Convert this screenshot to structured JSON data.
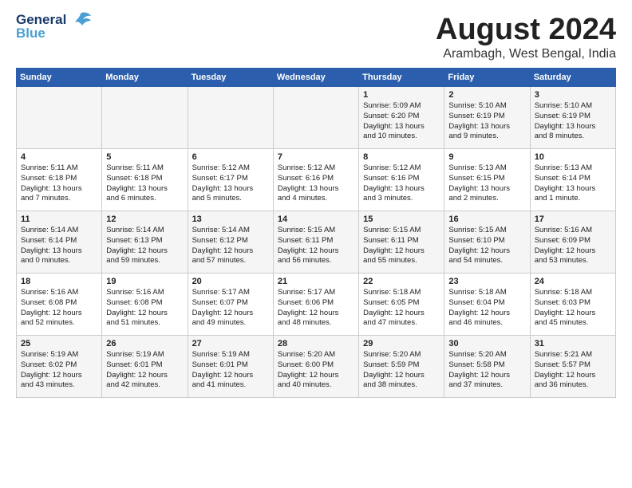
{
  "header": {
    "logo_line1": "General",
    "logo_line2": "Blue",
    "main_title": "August 2024",
    "subtitle": "Arambagh, West Bengal, India"
  },
  "calendar": {
    "days_of_week": [
      "Sunday",
      "Monday",
      "Tuesday",
      "Wednesday",
      "Thursday",
      "Friday",
      "Saturday"
    ],
    "weeks": [
      [
        {
          "day": "",
          "content": ""
        },
        {
          "day": "",
          "content": ""
        },
        {
          "day": "",
          "content": ""
        },
        {
          "day": "",
          "content": ""
        },
        {
          "day": "1",
          "content": "Sunrise: 5:09 AM\nSunset: 6:20 PM\nDaylight: 13 hours\nand 10 minutes."
        },
        {
          "day": "2",
          "content": "Sunrise: 5:10 AM\nSunset: 6:19 PM\nDaylight: 13 hours\nand 9 minutes."
        },
        {
          "day": "3",
          "content": "Sunrise: 5:10 AM\nSunset: 6:19 PM\nDaylight: 13 hours\nand 8 minutes."
        }
      ],
      [
        {
          "day": "4",
          "content": "Sunrise: 5:11 AM\nSunset: 6:18 PM\nDaylight: 13 hours\nand 7 minutes."
        },
        {
          "day": "5",
          "content": "Sunrise: 5:11 AM\nSunset: 6:18 PM\nDaylight: 13 hours\nand 6 minutes."
        },
        {
          "day": "6",
          "content": "Sunrise: 5:12 AM\nSunset: 6:17 PM\nDaylight: 13 hours\nand 5 minutes."
        },
        {
          "day": "7",
          "content": "Sunrise: 5:12 AM\nSunset: 6:16 PM\nDaylight: 13 hours\nand 4 minutes."
        },
        {
          "day": "8",
          "content": "Sunrise: 5:12 AM\nSunset: 6:16 PM\nDaylight: 13 hours\nand 3 minutes."
        },
        {
          "day": "9",
          "content": "Sunrise: 5:13 AM\nSunset: 6:15 PM\nDaylight: 13 hours\nand 2 minutes."
        },
        {
          "day": "10",
          "content": "Sunrise: 5:13 AM\nSunset: 6:14 PM\nDaylight: 13 hours\nand 1 minute."
        }
      ],
      [
        {
          "day": "11",
          "content": "Sunrise: 5:14 AM\nSunset: 6:14 PM\nDaylight: 13 hours\nand 0 minutes."
        },
        {
          "day": "12",
          "content": "Sunrise: 5:14 AM\nSunset: 6:13 PM\nDaylight: 12 hours\nand 59 minutes."
        },
        {
          "day": "13",
          "content": "Sunrise: 5:14 AM\nSunset: 6:12 PM\nDaylight: 12 hours\nand 57 minutes."
        },
        {
          "day": "14",
          "content": "Sunrise: 5:15 AM\nSunset: 6:11 PM\nDaylight: 12 hours\nand 56 minutes."
        },
        {
          "day": "15",
          "content": "Sunrise: 5:15 AM\nSunset: 6:11 PM\nDaylight: 12 hours\nand 55 minutes."
        },
        {
          "day": "16",
          "content": "Sunrise: 5:15 AM\nSunset: 6:10 PM\nDaylight: 12 hours\nand 54 minutes."
        },
        {
          "day": "17",
          "content": "Sunrise: 5:16 AM\nSunset: 6:09 PM\nDaylight: 12 hours\nand 53 minutes."
        }
      ],
      [
        {
          "day": "18",
          "content": "Sunrise: 5:16 AM\nSunset: 6:08 PM\nDaylight: 12 hours\nand 52 minutes."
        },
        {
          "day": "19",
          "content": "Sunrise: 5:16 AM\nSunset: 6:08 PM\nDaylight: 12 hours\nand 51 minutes."
        },
        {
          "day": "20",
          "content": "Sunrise: 5:17 AM\nSunset: 6:07 PM\nDaylight: 12 hours\nand 49 minutes."
        },
        {
          "day": "21",
          "content": "Sunrise: 5:17 AM\nSunset: 6:06 PM\nDaylight: 12 hours\nand 48 minutes."
        },
        {
          "day": "22",
          "content": "Sunrise: 5:18 AM\nSunset: 6:05 PM\nDaylight: 12 hours\nand 47 minutes."
        },
        {
          "day": "23",
          "content": "Sunrise: 5:18 AM\nSunset: 6:04 PM\nDaylight: 12 hours\nand 46 minutes."
        },
        {
          "day": "24",
          "content": "Sunrise: 5:18 AM\nSunset: 6:03 PM\nDaylight: 12 hours\nand 45 minutes."
        }
      ],
      [
        {
          "day": "25",
          "content": "Sunrise: 5:19 AM\nSunset: 6:02 PM\nDaylight: 12 hours\nand 43 minutes."
        },
        {
          "day": "26",
          "content": "Sunrise: 5:19 AM\nSunset: 6:01 PM\nDaylight: 12 hours\nand 42 minutes."
        },
        {
          "day": "27",
          "content": "Sunrise: 5:19 AM\nSunset: 6:01 PM\nDaylight: 12 hours\nand 41 minutes."
        },
        {
          "day": "28",
          "content": "Sunrise: 5:20 AM\nSunset: 6:00 PM\nDaylight: 12 hours\nand 40 minutes."
        },
        {
          "day": "29",
          "content": "Sunrise: 5:20 AM\nSunset: 5:59 PM\nDaylight: 12 hours\nand 38 minutes."
        },
        {
          "day": "30",
          "content": "Sunrise: 5:20 AM\nSunset: 5:58 PM\nDaylight: 12 hours\nand 37 minutes."
        },
        {
          "day": "31",
          "content": "Sunrise: 5:21 AM\nSunset: 5:57 PM\nDaylight: 12 hours\nand 36 minutes."
        }
      ]
    ]
  }
}
